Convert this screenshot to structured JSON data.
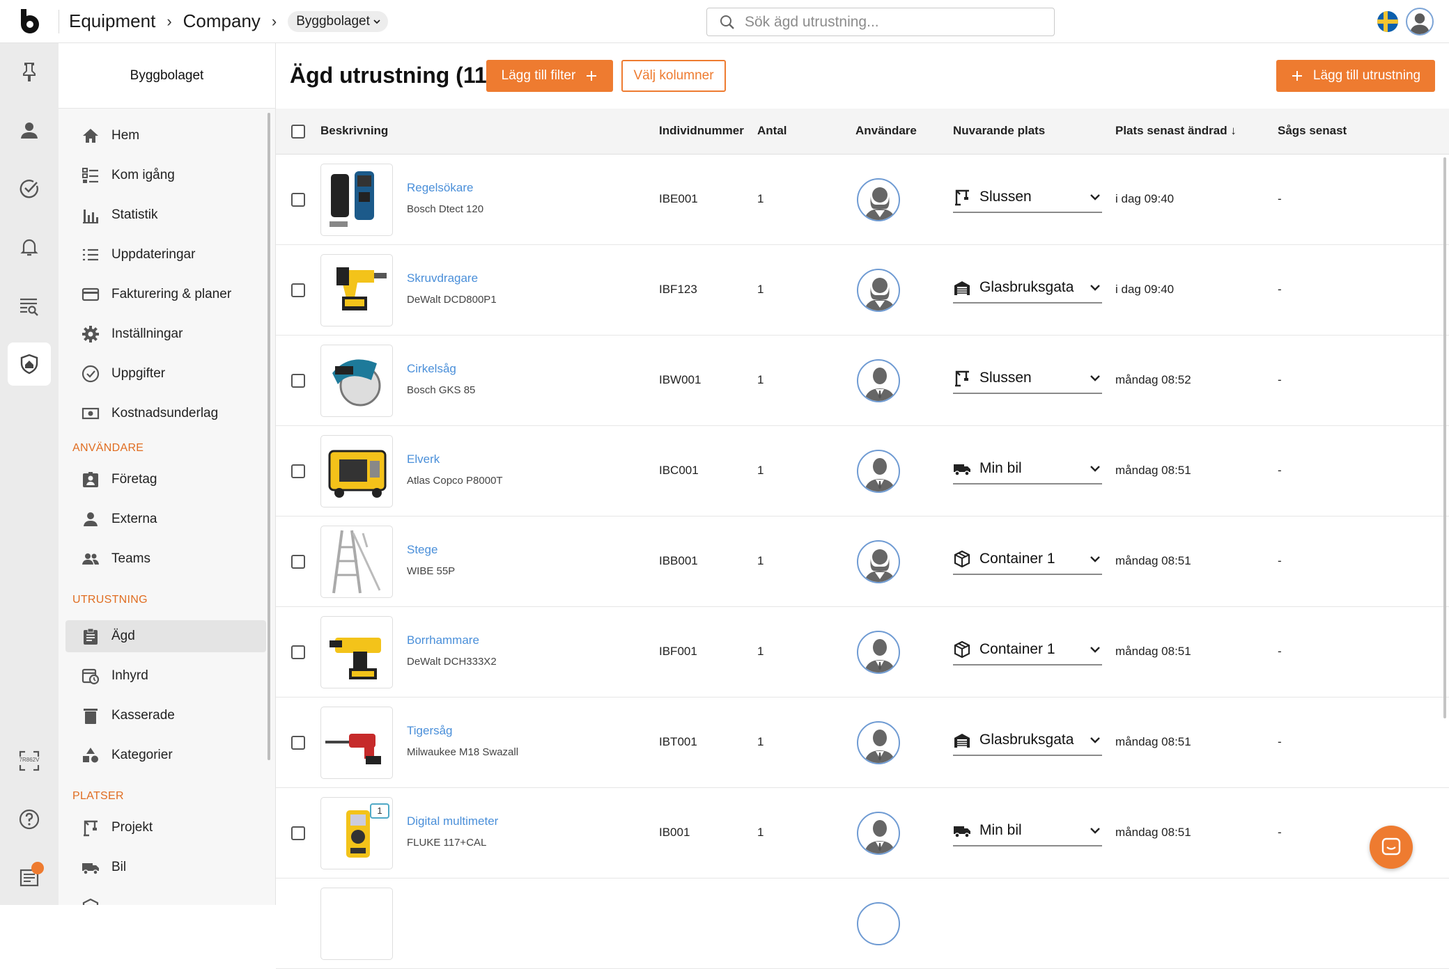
{
  "header": {
    "breadcrumb": [
      "Equipment",
      "Company"
    ],
    "org_selector": "Byggbolaget",
    "search_placeholder": "Sök ägd utrustning...",
    "language_flag": "sweden-flag-icon"
  },
  "rail": {
    "icons": [
      "pin-icon",
      "person-icon",
      "check-circle-icon",
      "bell-icon",
      "search-list-icon",
      "shield-home-icon",
      "qr-scan-icon",
      "help-icon",
      "news-icon"
    ],
    "active": "shield-home-icon",
    "qr_code_text": "7R862V"
  },
  "sidebar": {
    "title": "Byggbolaget",
    "main_items": [
      {
        "label": "Hem",
        "icon": "home-icon"
      },
      {
        "label": "Kom igång",
        "icon": "checklist-icon"
      },
      {
        "label": "Statistik",
        "icon": "bar-chart-icon"
      },
      {
        "label": "Uppdateringar",
        "icon": "list-icon"
      },
      {
        "label": "Fakturering & planer",
        "icon": "credit-card-icon"
      },
      {
        "label": "Inställningar",
        "icon": "gear-icon"
      },
      {
        "label": "Uppgifter",
        "icon": "check-circle-icon"
      },
      {
        "label": "Kostnadsunderlag",
        "icon": "money-icon"
      }
    ],
    "section_users": "ANVÄNDARE",
    "user_items": [
      {
        "label": "Företag",
        "icon": "badge-icon"
      },
      {
        "label": "Externa",
        "icon": "person-icon"
      },
      {
        "label": "Teams",
        "icon": "group-icon"
      }
    ],
    "section_equipment": "UTRUSTNING",
    "equipment_items": [
      {
        "label": "Ägd",
        "icon": "clipboard-icon",
        "active": true
      },
      {
        "label": "Inhyrd",
        "icon": "calendar-clock-icon"
      },
      {
        "label": "Kasserade",
        "icon": "trash-icon"
      },
      {
        "label": "Kategorier",
        "icon": "shapes-icon"
      }
    ],
    "section_places": "PLATSER",
    "place_items": [
      {
        "label": "Projekt",
        "icon": "crane-icon"
      },
      {
        "label": "Bil",
        "icon": "truck-icon"
      }
    ]
  },
  "main": {
    "title": "Ägd utrustning (11)",
    "add_filter": "Lägg till filter",
    "choose_columns": "Välj kolumner",
    "add_equipment": "Lägg till utrustning",
    "columns": {
      "description": "Beskrivning",
      "serial": "Individnummer",
      "count": "Antal",
      "user": "Användare",
      "location": "Nuvarande plats",
      "changed": "Plats senast ändrad ↓",
      "seen": "Sågs senast"
    },
    "rows": [
      {
        "name": "Regelsökare",
        "model": "Bosch Dtect 120",
        "serial": "IBE001",
        "count": "1",
        "location": "Slussen",
        "loc_icon": "crane-icon",
        "changed": "i dag 09:40",
        "seen": "-",
        "avatar": "female"
      },
      {
        "name": "Skruvdragare",
        "model": "DeWalt DCD800P1",
        "serial": "IBF123",
        "count": "1",
        "location": "Glasbruksgata",
        "loc_icon": "warehouse-icon",
        "changed": "i dag 09:40",
        "seen": "-",
        "avatar": "female"
      },
      {
        "name": "Cirkelsåg",
        "model": "Bosch GKS 85",
        "serial": "IBW001",
        "count": "1",
        "location": "Slussen",
        "loc_icon": "crane-icon",
        "changed": "måndag 08:52",
        "seen": "-",
        "avatar": "male"
      },
      {
        "name": "Elverk",
        "model": "Atlas Copco P8000T",
        "serial": "IBC001",
        "count": "1",
        "location": "Min bil",
        "loc_icon": "truck-icon",
        "changed": "måndag 08:51",
        "seen": "-",
        "avatar": "male"
      },
      {
        "name": "Stege",
        "model": "WIBE 55P",
        "serial": "IBB001",
        "count": "1",
        "location": "Container 1",
        "loc_icon": "box-icon",
        "changed": "måndag 08:51",
        "seen": "-",
        "avatar": "female"
      },
      {
        "name": "Borrhammare",
        "model": "DeWalt DCH333X2",
        "serial": "IBF001",
        "count": "1",
        "location": "Container 1",
        "loc_icon": "box-icon",
        "changed": "måndag 08:51",
        "seen": "-",
        "avatar": "male"
      },
      {
        "name": "Tigersåg",
        "model": "Milwaukee M18 Swazall",
        "serial": "IBT001",
        "count": "1",
        "location": "Glasbruksgata",
        "loc_icon": "warehouse-icon",
        "changed": "måndag 08:51",
        "seen": "-",
        "avatar": "male"
      },
      {
        "name": "Digital multimeter",
        "model": "FLUKE 117+CAL",
        "serial": "IB001",
        "count": "1",
        "location": "Min bil",
        "loc_icon": "truck-icon",
        "changed": "måndag 08:51",
        "seen": "-",
        "avatar": "male",
        "note_count": "1"
      }
    ]
  },
  "colors": {
    "accent": "#ee7b30",
    "link": "#4a8fd9",
    "section": "#e06d21"
  }
}
